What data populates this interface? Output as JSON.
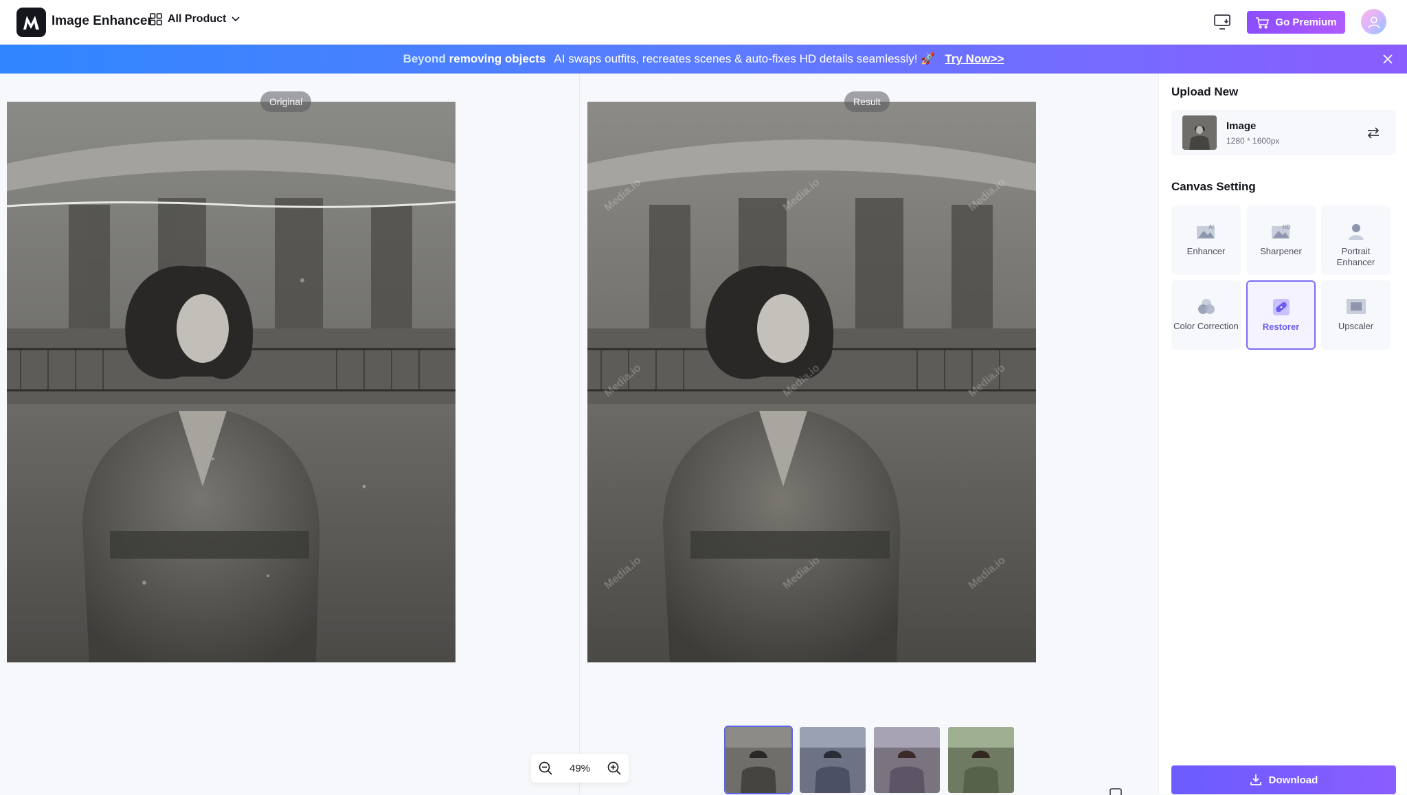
{
  "header": {
    "logo_icon": "media-io-logo-icon",
    "app_title": "Image Enhancer",
    "all_product_label": "All Product",
    "premium_label": "Go Premium",
    "brand_color": "#8a4dff"
  },
  "banner": {
    "lead_highlight": "Beyond",
    "lead_rest": "removing objects",
    "message": "AI swaps outfits, recreates scenes & auto-fixes HD details seamlessly! 🚀",
    "link": "Try Now>>"
  },
  "canvas": {
    "original_label": "Original",
    "result_label": "Result",
    "zoom": "49%",
    "thumbnails": [
      {
        "name": "thumb-grayscale",
        "active": true
      },
      {
        "name": "thumb-blue",
        "active": false
      },
      {
        "name": "thumb-warm",
        "active": false
      },
      {
        "name": "thumb-green",
        "active": false
      }
    ]
  },
  "panel": {
    "upload_title": "Upload New",
    "image_name": "Image",
    "image_size": "1280 * 1600px",
    "canvas_title": "Canvas Setting",
    "tools": [
      {
        "label": "Enhancer",
        "icon": "ai-image-icon",
        "active": false
      },
      {
        "label": "Sharpener",
        "icon": "hd-image-icon",
        "active": false
      },
      {
        "label": "Portrait Enhancer",
        "icon": "portrait-icon",
        "active": false
      },
      {
        "label": "Color Correction",
        "icon": "color-circles-icon",
        "active": false
      },
      {
        "label": "Restorer",
        "icon": "bandage-icon",
        "active": true
      },
      {
        "label": "Upscaler",
        "icon": "upscale-icon",
        "active": false
      }
    ],
    "download_label": "Download",
    "accent_color": "#6b5cff"
  }
}
